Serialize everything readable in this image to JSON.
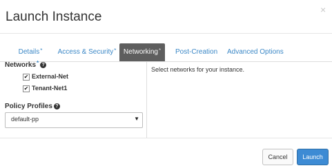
{
  "dialog": {
    "title": "Launch Instance",
    "close_glyph": "×"
  },
  "tabs": [
    {
      "label": "Details",
      "required": "*",
      "active": false
    },
    {
      "label": "Access & Security",
      "required": "*",
      "active": false
    },
    {
      "label": "Networking",
      "required": "*",
      "active": true
    },
    {
      "label": "Post-Creation",
      "required": "",
      "active": false
    },
    {
      "label": "Advanced Options",
      "required": "",
      "active": false
    }
  ],
  "networks": {
    "label": "Networks",
    "required": "*",
    "help_glyph": "?",
    "items": [
      {
        "label": "External-Net",
        "checked": true
      },
      {
        "label": "Tenant-Net1",
        "checked": true
      }
    ]
  },
  "policy_profiles": {
    "label": "Policy Profiles",
    "help_glyph": "?",
    "selected": "default-pp"
  },
  "description": "Select networks for your instance.",
  "footer": {
    "cancel_label": "Cancel",
    "launch_label": "Launch"
  },
  "colors": {
    "link": "#3a87c6",
    "active_tab_bg": "#5e5e5e",
    "primary_button": "#3d8bd4"
  },
  "icons": {
    "close": "close-icon",
    "help": "question-circle-icon",
    "check": "checkmark-icon",
    "dropdown": "caret-down-icon"
  }
}
